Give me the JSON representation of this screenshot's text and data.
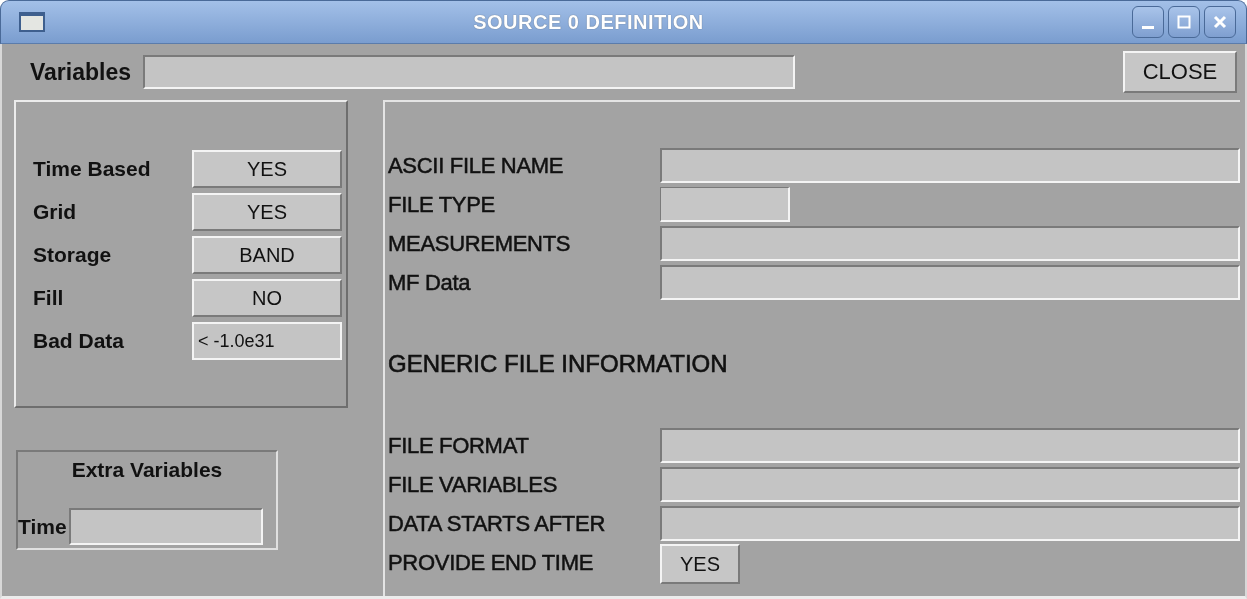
{
  "window": {
    "title": "SOURCE 0 DEFINITION"
  },
  "variables": {
    "label": "Variables"
  },
  "close_button": {
    "label": "CLOSE"
  },
  "options": [
    {
      "label": "Time Based",
      "value": "YES",
      "kind": "button"
    },
    {
      "label": "Grid",
      "value": "YES",
      "kind": "button"
    },
    {
      "label": "Storage",
      "value": "BAND",
      "kind": "button"
    },
    {
      "label": "Fill",
      "value": "NO",
      "kind": "button"
    },
    {
      "label": "Bad Data",
      "value": "< -1.0e31",
      "kind": "field"
    }
  ],
  "extra_variables": {
    "title": "Extra Variables",
    "fields": [
      {
        "label": "Time"
      }
    ]
  },
  "file_fields": [
    {
      "label": "ASCII FILE NAME",
      "kind": "field"
    },
    {
      "label": "FILE TYPE",
      "kind": "menu"
    },
    {
      "label": "MEASUREMENTS",
      "kind": "field"
    },
    {
      "label": "MF Data",
      "kind": "field"
    }
  ],
  "generic_heading": "GENERIC FILE INFORMATION",
  "generic_fields": [
    {
      "label": "FILE FORMAT",
      "kind": "field"
    },
    {
      "label": "FILE VARIABLES",
      "kind": "field"
    },
    {
      "label": "DATA STARTS AFTER",
      "kind": "field"
    },
    {
      "label": "PROVIDE END TIME",
      "kind": "button",
      "value": "YES"
    }
  ]
}
